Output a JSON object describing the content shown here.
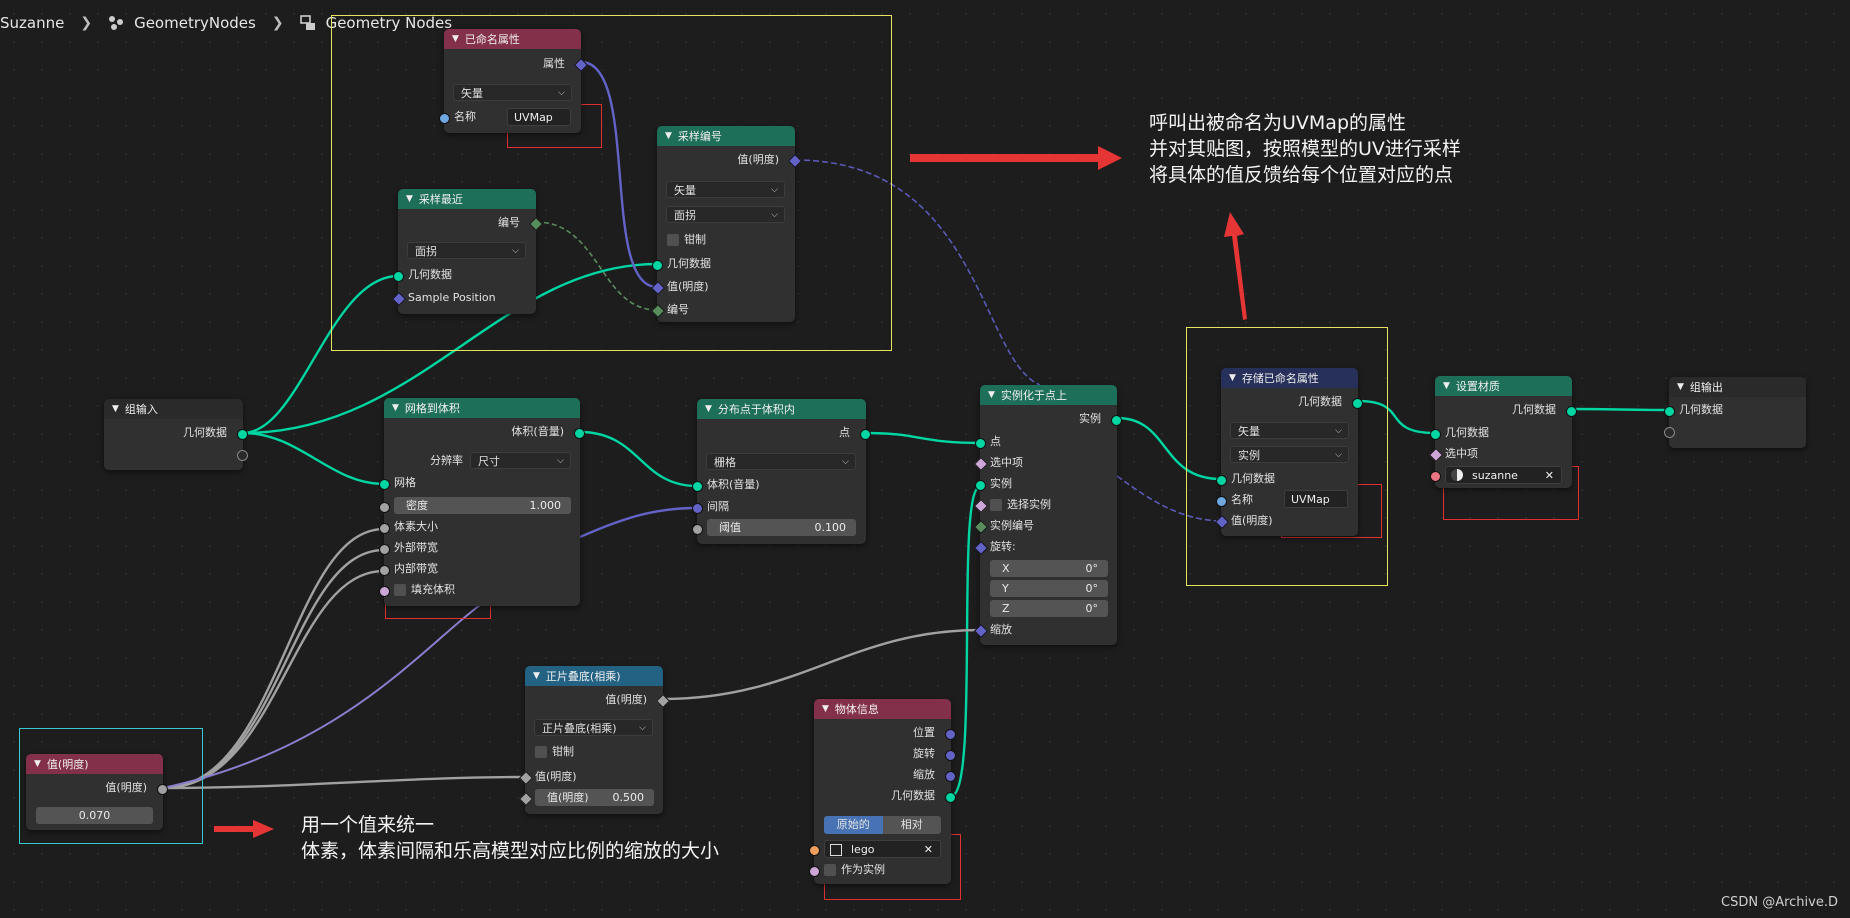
{
  "breadcrumb": {
    "object": "Suzanne",
    "modifier": "GeometryNodes",
    "tree": "Geometry Nodes"
  },
  "colors": {
    "geometry_socket": "#00d6a3",
    "vector_socket": "#6363c7",
    "float_socket": "#a1a1a1",
    "int_socket": "#598c5c",
    "bool_socket": "#cca6d6",
    "object_socket": "#ed9e5c",
    "material_socket": "#eb7582",
    "header_attribute": "#83314a",
    "header_geometry": "#1e6f5a",
    "header_converter": "#246283",
    "header_input": "#83314a",
    "header_output": "#2a2a2a",
    "header_store": "#27305a",
    "annotation_yellow": "#e6e35c",
    "annotation_red": "#e03030",
    "annotation_cyan": "#39c7d6"
  },
  "nodes": {
    "named_attr": {
      "title": "已命名属性",
      "out_attribute": "属性",
      "type": "矢量",
      "name_label": "名称",
      "name_value": "UVMap"
    },
    "sample_index": {
      "title": "采样编号",
      "out_value": "值(明度)",
      "type": "矢量",
      "domain": "面拐",
      "clamp": "钳制",
      "in_geometry": "几何数据",
      "in_value": "值(明度)",
      "in_index": "编号"
    },
    "sample_nearest": {
      "title": "采样最近",
      "out_index": "编号",
      "domain": "面拐",
      "in_geometry": "几何数据",
      "in_position": "Sample Position"
    },
    "group_input": {
      "title": "组输入",
      "out_geometry": "几何数据"
    },
    "mesh_to_volume": {
      "title": "网格到体积",
      "out_volume": "体积(音量)",
      "resolution_label": "分辨率",
      "resolution_value": "尺寸",
      "in_mesh": "网格",
      "density_label": "密度",
      "density_value": "1.000",
      "voxel_size": "体素大小",
      "exterior_band": "外部带宽",
      "interior_band": "内部带宽",
      "fill_volume": "填充体积"
    },
    "distribute_points": {
      "title": "分布点于体积内",
      "out_points": "点",
      "mode": "栅格",
      "in_volume": "体积(音量)",
      "spacing": "间隔",
      "threshold_label": "阈值",
      "threshold_value": "0.100"
    },
    "instance_on_points": {
      "title": "实例化于点上",
      "out_instances": "实例",
      "in_points": "点",
      "selection": "选中项",
      "instance": "实例",
      "pick_instance": "选择实例",
      "instance_index": "实例编号",
      "rotation": "旋转:",
      "rot_x_label": "X",
      "rot_x_value": "0°",
      "rot_y_label": "Y",
      "rot_y_value": "0°",
      "rot_z_label": "Z",
      "rot_z_value": "0°",
      "scale": "缩放"
    },
    "store_named_attr": {
      "title": "存储已命名属性",
      "out_geometry": "几何数据",
      "type": "矢量",
      "domain": "实例",
      "in_geometry": "几何数据",
      "name_label": "名称",
      "name_value": "UVMap",
      "in_value": "值(明度)"
    },
    "set_material": {
      "title": "设置材质",
      "out_geometry": "几何数据",
      "in_geometry": "几何数据",
      "selection": "选中项",
      "material": "suzanne"
    },
    "group_output": {
      "title": "组输出",
      "in_geometry": "几何数据"
    },
    "ping_pong": {
      "title": "正片叠底(相乘)",
      "out_value": "值(明度)",
      "operation": "正片叠底(相乘)",
      "clamp": "钳制",
      "in_value": "值(明度)",
      "value2_label": "值(明度)",
      "value2_value": "0.500"
    },
    "value": {
      "title": "值(明度)",
      "out_value": "值(明度)",
      "value": "0.070"
    },
    "object_info": {
      "title": "物体信息",
      "location": "位置",
      "rotation": "旋转",
      "scale": "缩放",
      "geometry": "几何数据",
      "tab_original": "原始的",
      "tab_relative": "相对",
      "object": "lego",
      "as_instance": "作为实例"
    }
  },
  "annotations": {
    "top_right": [
      "呼叫出被命名为UVMap的属性",
      "并对其贴图，按照模型的UV进行采样",
      "将具体的值反馈给每个位置对应的点"
    ],
    "bottom_left": [
      "用一个值来统一",
      "体素，体素间隔和乐高模型对应比例的缩放的大小"
    ]
  },
  "watermark": "CSDN @Archive.D"
}
